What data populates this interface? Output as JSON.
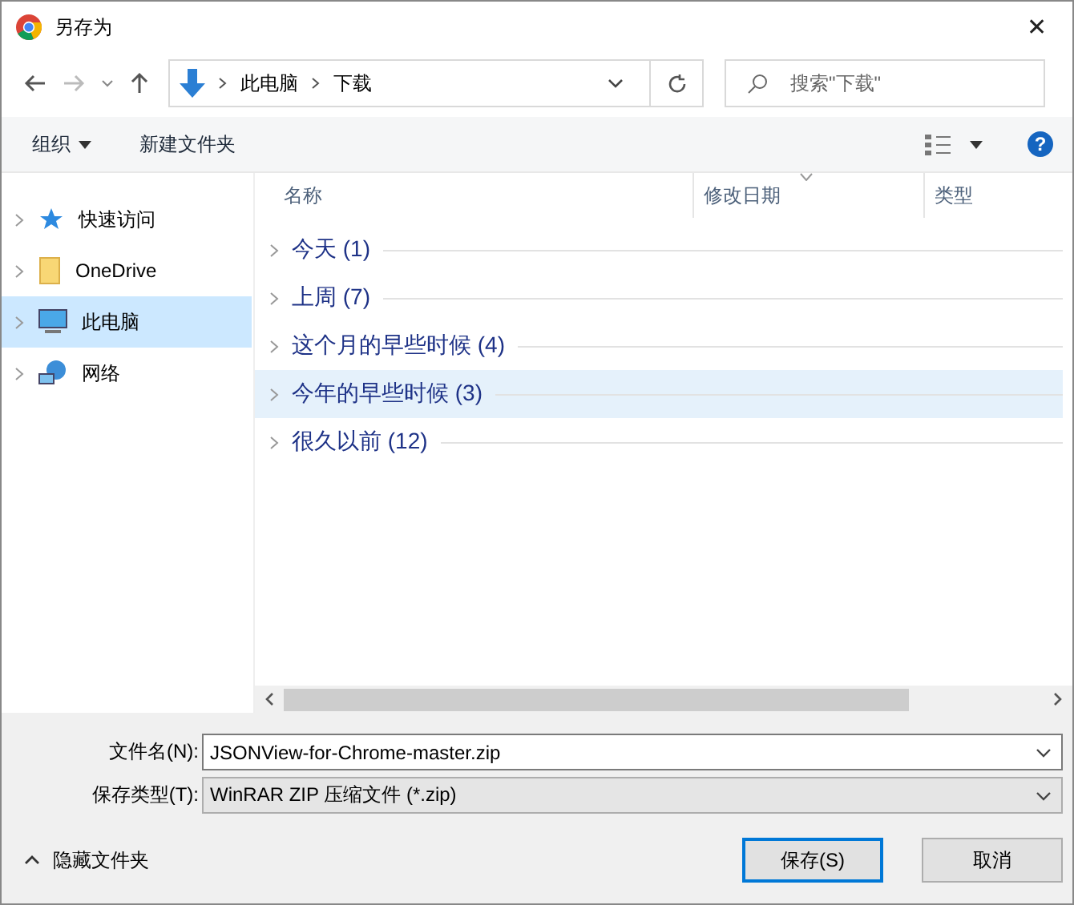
{
  "window": {
    "title": "另存为",
    "close": "✕"
  },
  "address": {
    "path": [
      {
        "label": "此电脑"
      },
      {
        "label": "下载"
      }
    ],
    "search_placeholder": "搜索\"下载\""
  },
  "toolbar": {
    "organize": "组织",
    "new_folder": "新建文件夹",
    "help": "?"
  },
  "sidebar": {
    "items": [
      {
        "label": "快速访问",
        "kind": "star",
        "selected": false
      },
      {
        "label": "OneDrive",
        "kind": "folder",
        "selected": false
      },
      {
        "label": "此电脑",
        "kind": "computer",
        "selected": true
      },
      {
        "label": "网络",
        "kind": "network",
        "selected": false
      }
    ]
  },
  "table": {
    "columns": [
      "名称",
      "修改日期",
      "类型"
    ],
    "groups": [
      {
        "label": "今天 (1)",
        "selected": false
      },
      {
        "label": "上周 (7)",
        "selected": false
      },
      {
        "label": "这个月的早些时候 (4)",
        "selected": false
      },
      {
        "label": "今年的早些时候 (3)",
        "selected": true
      },
      {
        "label": "很久以前 (12)",
        "selected": false
      }
    ]
  },
  "form": {
    "filename_label": "文件名(N):",
    "filename": "JSONView-for-Chrome-master.zip",
    "type_label": "保存类型(T):",
    "type": "WinRAR ZIP 压缩文件 (*.zip)"
  },
  "footer": {
    "hide_folders": "隐藏文件夹",
    "buttons": [
      {
        "label": "保存(S)",
        "kind": "primary"
      },
      {
        "label": "取消",
        "kind": "normal"
      }
    ]
  }
}
